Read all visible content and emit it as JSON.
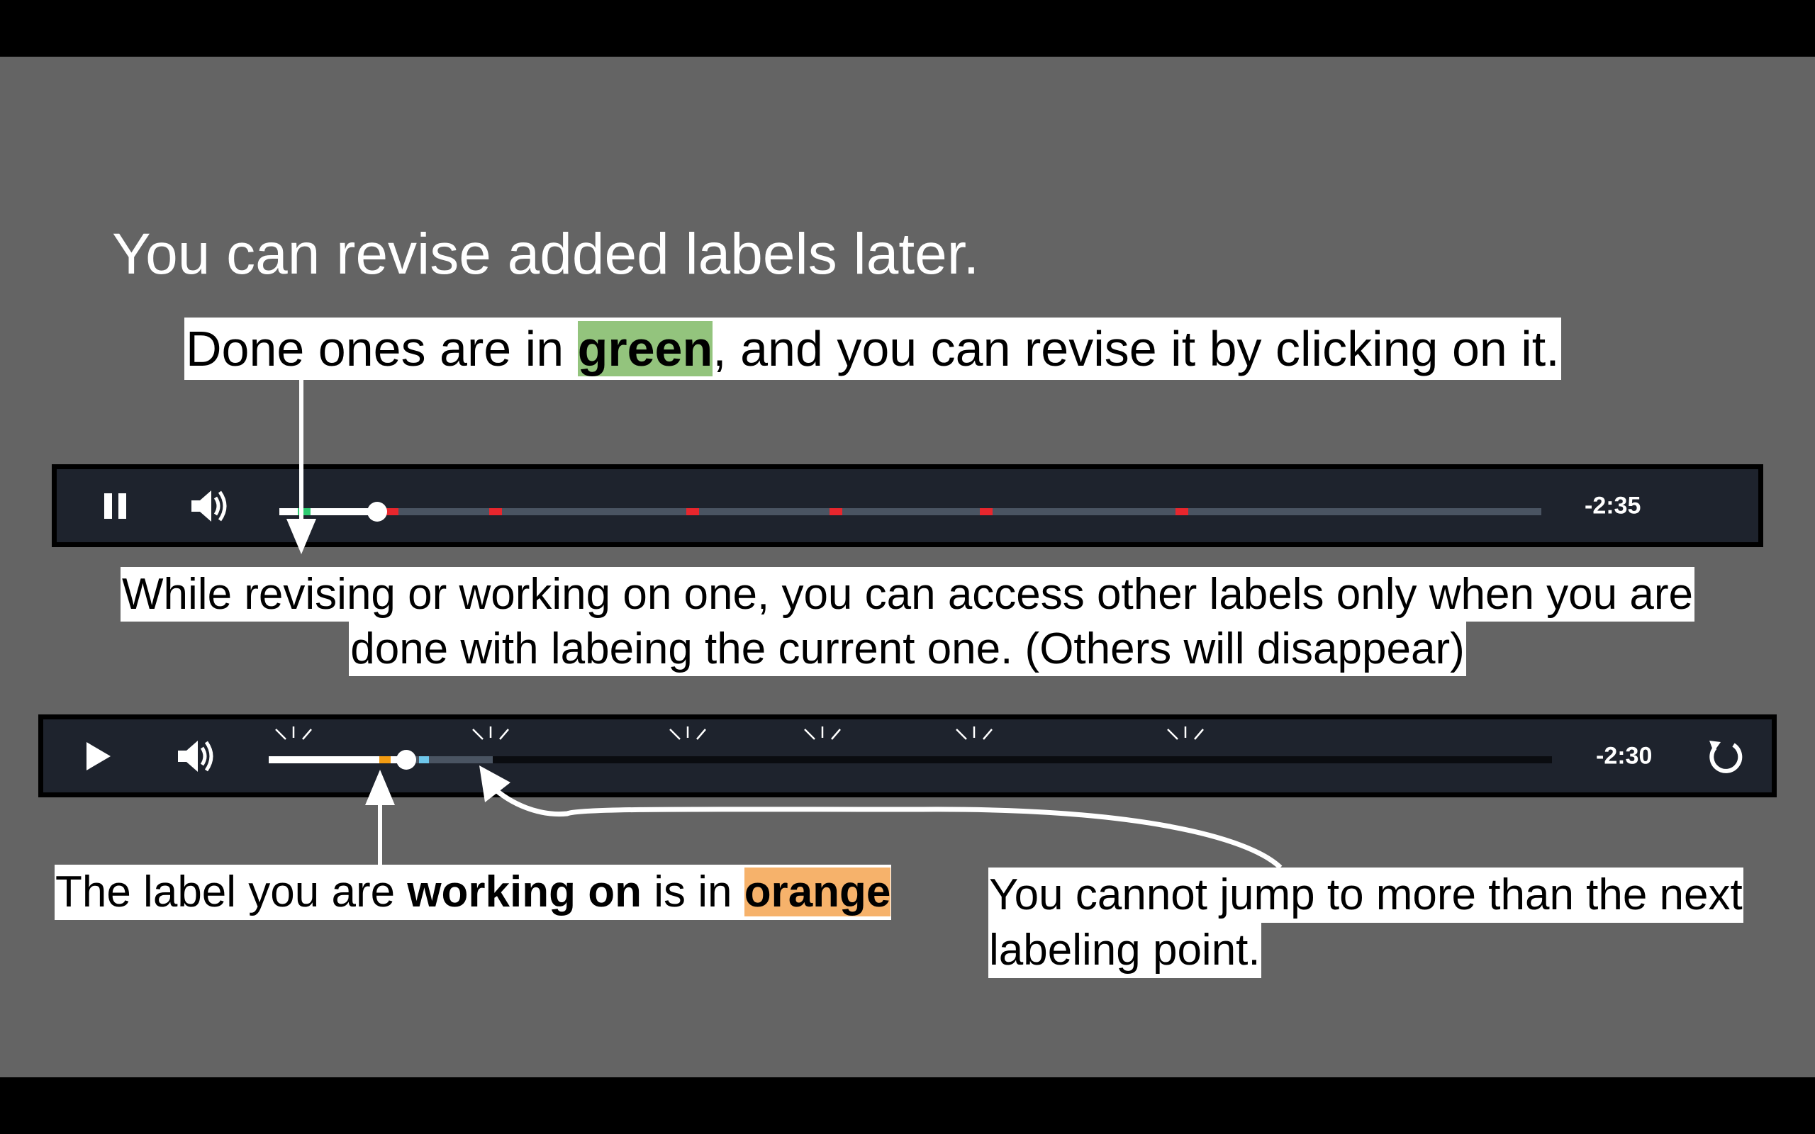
{
  "slide": {
    "title": "You can revise added labels later."
  },
  "callouts": {
    "done": {
      "before": "Done ones are in ",
      "highlight": "green",
      "after": ", and you can revise it by clicking on it."
    },
    "revising": {
      "line1": "While revising or working on one, you can access other labels only when you are",
      "line2": "done with labeing the current one. (Others will disappear)"
    },
    "working": {
      "before": "The label you are ",
      "bold": "working on",
      "middle": " is in ",
      "highlight": "orange"
    },
    "jump": {
      "line1": "You cannot jump to more than the next",
      "line2": "labeling point."
    }
  },
  "player_top": {
    "state_button": "pause-icon",
    "volume": "volume-icon",
    "time_remaining": "-2:35",
    "progress_fraction": 0.078,
    "done_label_color": "#2ecc71",
    "pending_label_color": "#e8262d"
  },
  "player_bottom": {
    "state_button": "play-icon",
    "volume": "volume-icon",
    "time_remaining": "-2:30",
    "replay": "replay-icon",
    "progress_fraction": 0.107,
    "working_label_color": "#f39c12",
    "accessible_color": "#4a90b8"
  },
  "colors": {
    "slide_bg": "#646464",
    "player_bg": "#1e232d",
    "highlight_green": "#93c47d",
    "highlight_orange": "#f6b26b"
  }
}
